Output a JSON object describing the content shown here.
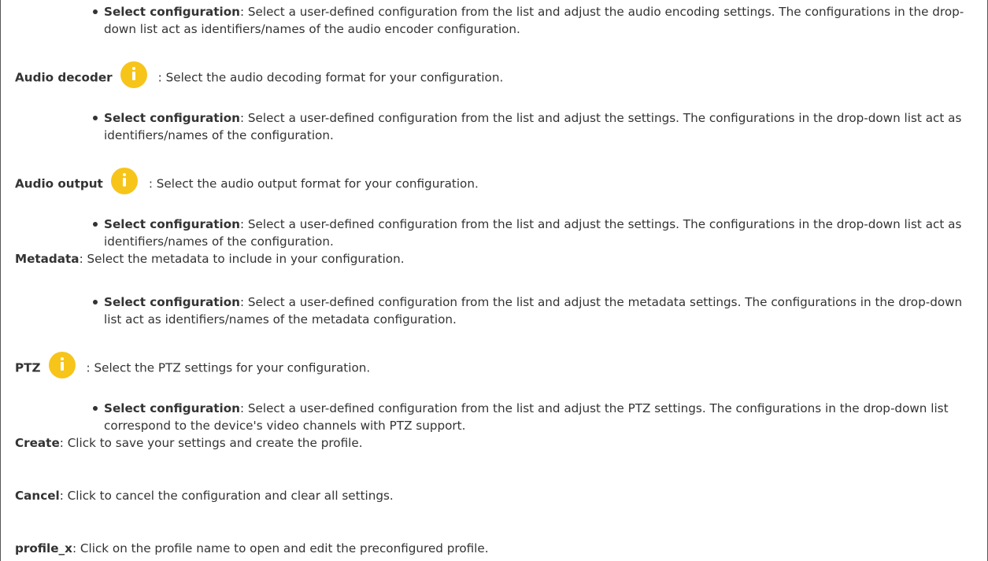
{
  "items": [
    {
      "type": "bullet",
      "term": "Select configuration",
      "text": ": Select a user-defined configuration from the list and adjust the audio encoding settings. The configurations in the drop-down list act as identifiers/names of the audio encoder configuration."
    },
    {
      "type": "term",
      "term": "Audio decoder",
      "text": ": Select the audio decoding format for your configuration.",
      "icon": "info-icon"
    },
    {
      "type": "bullet",
      "term": "Select configuration",
      "text": ": Select a user-defined configuration from the list and adjust the settings. The configurations in the drop-down list act as identifiers/names of the configuration."
    },
    {
      "type": "term",
      "term": "Audio output",
      "text": ": Select the audio output format for your configuration.",
      "icon": "info-icon"
    },
    {
      "type": "bullet",
      "term": "Select configuration",
      "text": ": Select a user-defined configuration from the list and adjust the settings. The configurations in the drop-down list act as identifiers/names of the configuration."
    },
    {
      "type": "term",
      "term": "Metadata",
      "text": ": Select the metadata to include in your configuration."
    },
    {
      "type": "bullet",
      "term": "Select configuration",
      "text": ": Select a user-defined configuration from the list and adjust the metadata settings. The configurations in the drop-down list act as identifiers/names of the metadata configuration."
    },
    {
      "type": "term",
      "term": "PTZ",
      "text": ": Select the PTZ settings for your configuration.",
      "icon": "info-icon"
    },
    {
      "type": "bullet",
      "term": "Select configuration",
      "text": ": Select a user-defined configuration from the list and adjust the PTZ settings. The configurations in the drop-down list correspond to the device's video channels with PTZ support."
    },
    {
      "type": "term",
      "term": "Create",
      "text": ": Click to save your settings and create the profile."
    },
    {
      "type": "term",
      "term": "Cancel",
      "text": ": Click to cancel the configuration and clear all settings."
    },
    {
      "type": "term",
      "term": "profile_x",
      "text": ": Click on the profile name to open and edit the preconfigured profile."
    }
  ],
  "colors": {
    "info_icon": "#f7c41a",
    "text": "#333333"
  }
}
